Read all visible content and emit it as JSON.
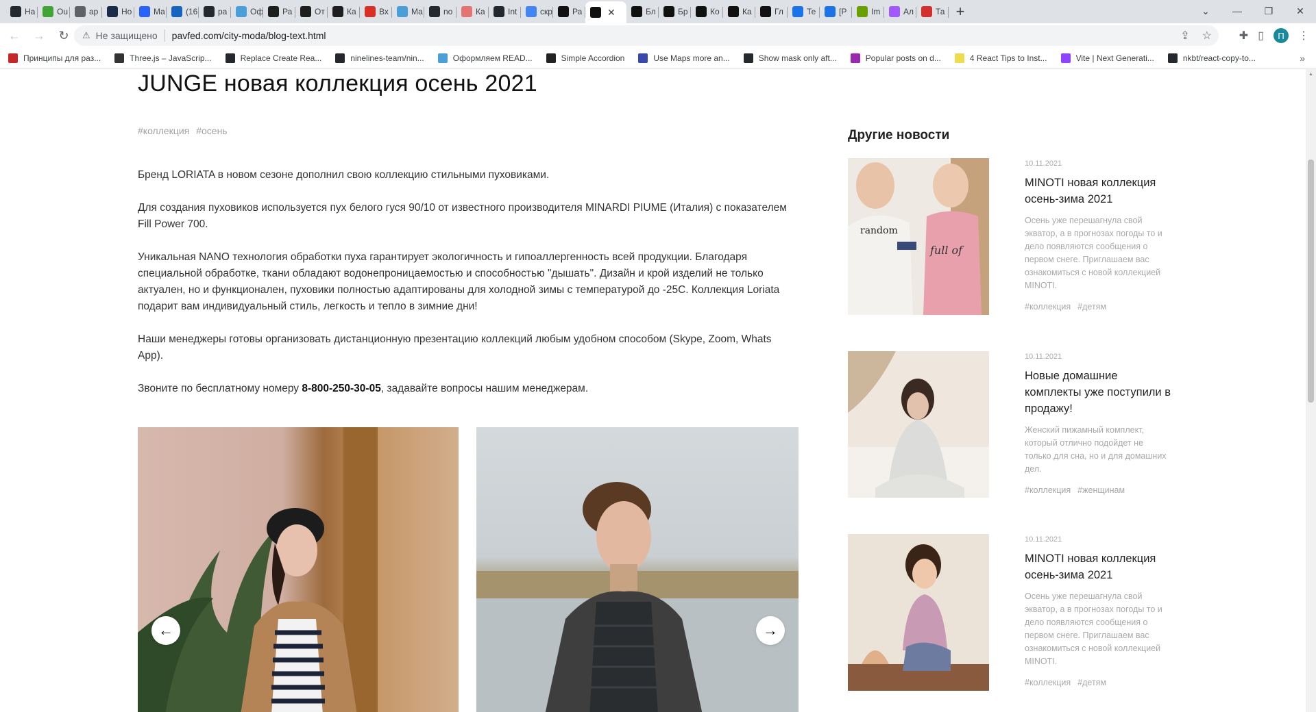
{
  "browser": {
    "tabs": [
      {
        "label": "На",
        "icon": "github-icon",
        "color": "#24292f"
      },
      {
        "label": "Ou",
        "icon": "outline-icon",
        "color": "#3fa535"
      },
      {
        "label": "ap",
        "icon": "app-icon",
        "color": "#5f6368"
      },
      {
        "label": "Но",
        "icon": "hn-icon",
        "color": "#1c2b4a"
      },
      {
        "label": "Ма",
        "icon": "mail-icon",
        "color": "#2962ff"
      },
      {
        "label": "(16",
        "icon": "inbox-icon",
        "color": "#1565c0"
      },
      {
        "label": "ра",
        "icon": "github-icon",
        "color": "#24292f"
      },
      {
        "label": "Оф",
        "icon": "react-icon",
        "color": "#4a9fd8"
      },
      {
        "label": "Ра",
        "icon": "deu-icon",
        "color": "#1e1e1e"
      },
      {
        "label": "От",
        "icon": "deu-icon",
        "color": "#1e1e1e"
      },
      {
        "label": "Ка",
        "icon": "deu-icon",
        "color": "#1e1e1e"
      },
      {
        "label": "Вх",
        "icon": "gmail-icon",
        "color": "#d93025"
      },
      {
        "label": "Ма",
        "icon": "tab-icon",
        "color": "#4a9fd8"
      },
      {
        "label": "no",
        "icon": "github-icon",
        "color": "#24292f"
      },
      {
        "label": "Ка",
        "icon": "gmail-icon",
        "color": "#e57373"
      },
      {
        "label": "Int",
        "icon": "github-icon",
        "color": "#24292f"
      },
      {
        "label": "скр",
        "icon": "google-icon",
        "color": "#4285f4"
      },
      {
        "label": "Ра",
        "icon": "c-icon",
        "color": "#111111"
      },
      {
        "label": "",
        "icon": "c-icon",
        "color": "#111111",
        "active": true
      },
      {
        "label": "Бл",
        "icon": "c-icon",
        "color": "#111111"
      },
      {
        "label": "Бр",
        "icon": "c-icon",
        "color": "#111111"
      },
      {
        "label": "Ко",
        "icon": "c-icon",
        "color": "#111111"
      },
      {
        "label": "Ка",
        "icon": "c-icon",
        "color": "#111111"
      },
      {
        "label": "Гл",
        "icon": "c-icon",
        "color": "#111111"
      },
      {
        "label": "Те",
        "icon": "diamond-icon",
        "color": "#1a73e8"
      },
      {
        "label": "[Р",
        "icon": "diamond-icon",
        "color": "#1a73e8"
      },
      {
        "label": "Im",
        "icon": "img-icon",
        "color": "#6a9f00"
      },
      {
        "label": "Ал",
        "icon": "figma-icon",
        "color": "#a259ff"
      },
      {
        "label": "Та",
        "icon": "record-icon",
        "color": "#d32f2f"
      }
    ],
    "insecure_label": "Не защищено",
    "url": "pavfed.com/city-moda/blog-text.html",
    "profile_initial": "П",
    "bookmarks": [
      {
        "label": "Принципы для раз...",
        "icon": "bookmark-icon",
        "color": "#c62828"
      },
      {
        "label": "Three.js – JavaScrip...",
        "icon": "threejs-icon",
        "color": "#333333"
      },
      {
        "label": "Replace Create Rea...",
        "icon": "github-icon",
        "color": "#24292f"
      },
      {
        "label": "ninelines-team/nin...",
        "icon": "github-icon",
        "color": "#24292f"
      },
      {
        "label": "Оформляем READ...",
        "icon": "react-icon",
        "color": "#4a9fd8"
      },
      {
        "label": "Simple Accordion",
        "icon": "codepen-icon",
        "color": "#222222"
      },
      {
        "label": "Use Maps more an...",
        "icon": "flag-icon",
        "color": "#3949ab"
      },
      {
        "label": "Show mask only aft...",
        "icon": "github-icon",
        "color": "#24292f"
      },
      {
        "label": "Popular posts on d...",
        "icon": "infinity-icon",
        "color": "#9c27b0"
      },
      {
        "label": "4 React Tips to Inst...",
        "icon": "js-icon",
        "color": "#f0db4f"
      },
      {
        "label": "Vite | Next Generati...",
        "icon": "vite-icon",
        "color": "#8e44ff"
      },
      {
        "label": "nkbt/react-copy-to...",
        "icon": "github-icon",
        "color": "#24292f"
      }
    ]
  },
  "article": {
    "title": "JUNGE новая коллекция осень 2021",
    "tags": [
      "#коллекция",
      "#осень"
    ],
    "paragraphs": [
      "Бренд LORIATA в новом сезоне дополнил свою коллекцию стильными пуховиками.",
      "Для создания пуховиков используется пух белого гуся 90/10 от известного производителя MINARDI PIUME (Италия) с показателем Fill Power 700.",
      "Уникальная NANO технология обработки пуха гарантирует экологичность и гипоаллергенность всей продукции. Благодаря специальной обработке, ткани обладают водонепроницаемостью и способностью \"дышать\". Дизайн и крой изделий не только актуален, но и функционален, пуховики полностью адаптированы для холодной зимы с температурой до -25С. Коллекция Loriata подарит вам индивидуальный стиль, легкость и тепло в зимние дни!",
      "Наши менеджеры готовы организовать дистанционную презентацию коллекций любым удобном способом (Skype, Zoom, Whats App)."
    ],
    "call_prefix": "Звоните по бесплатному номеру ",
    "phone": "8-800-250-30-05",
    "call_suffix": ", задавайте вопросы нашим менеджерам."
  },
  "sidebar": {
    "title": "Другие новости",
    "items": [
      {
        "date": "10.11.2021",
        "title": "MINOTI новая коллекция осень-зима 2021",
        "excerpt": "Осень уже перешагнула свой экватор, а в прогнозах погоды то и дело появляются сообщения о первом снеге. Приглашаем вас ознакомиться с новой коллекцией MINOTI.",
        "tags": [
          "#коллекция",
          "#детям"
        ]
      },
      {
        "date": "10.11.2021",
        "title": "Новые домашние комплекты уже поступили в продажу!",
        "excerpt": "Женский пижамный комплект, который отлично подойдет не только для сна, но и для домашних дел.",
        "tags": [
          "#коллекция",
          "#женщинам"
        ]
      },
      {
        "date": "10.11.2021",
        "title": "MINOTI новая коллекция осень-зима 2021",
        "excerpt": "Осень уже перешагнула свой экватор, а в прогнозах погоды то и дело появляются сообщения о первом снеге. Приглашаем вас ознакомиться с новой коллекцией MINOTI.",
        "tags": [
          "#коллекция",
          "#детям"
        ]
      }
    ]
  },
  "gallery": {
    "prev_icon": "arrow-left-icon",
    "next_icon": "arrow-right-icon"
  }
}
